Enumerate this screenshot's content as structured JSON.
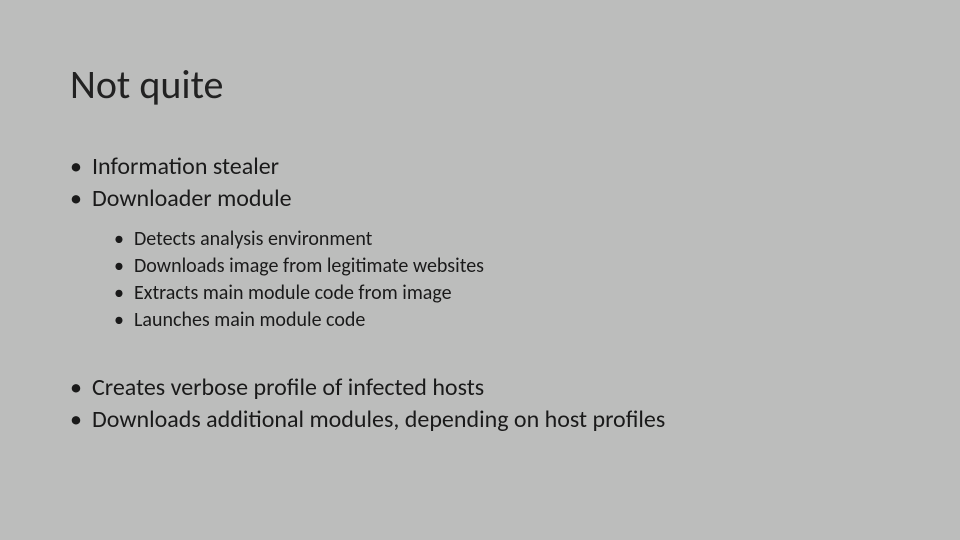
{
  "title": "Not quite",
  "bullets_top": [
    "Information stealer",
    "Downloader module"
  ],
  "sub_bullets": [
    "Detects analysis environment",
    "Downloads image from legitimate websites",
    "Extracts main module code from image",
    "Launches main module code"
  ],
  "bullets_bottom": [
    "Creates verbose profile of infected hosts",
    "Downloads additional modules, depending on host profiles"
  ]
}
